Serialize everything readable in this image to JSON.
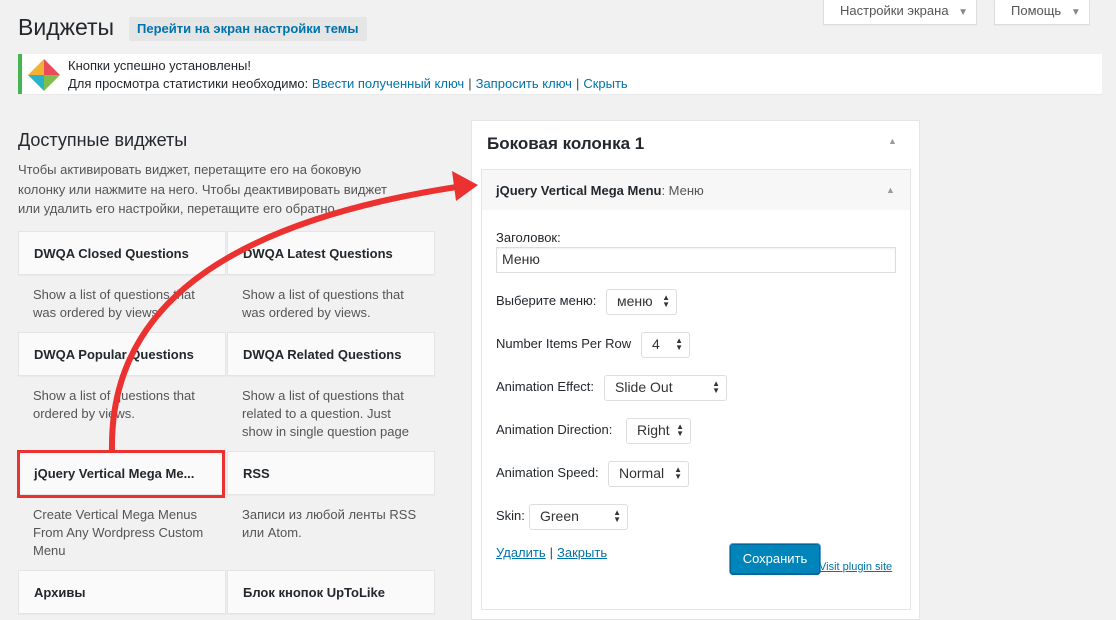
{
  "header": {
    "title": "Виджеты",
    "action_label": "Перейти на экран настройки темы",
    "screen_options": "Настройки экрана",
    "help": "Помощь"
  },
  "notice": {
    "line1": "Кнопки успешно установлены!",
    "line2_prefix": "Для просмотра статистики необходимо:",
    "link_enter_key": "Ввести полученный ключ",
    "link_request_key": "Запросить ключ",
    "link_hide": "Скрыть"
  },
  "available": {
    "heading": "Доступные виджеты",
    "description": "Чтобы активировать виджет, перетащите его на боковую колонку или нажмите на него. Чтобы деактивировать виджет или удалить его настройки, перетащите его обратно.",
    "widgets": [
      {
        "title": "DWQA Closed Questions",
        "desc": "Show a list of questions that was ordered by views."
      },
      {
        "title": "DWQA Latest Questions",
        "desc": "Show a list of questions that was ordered by views."
      },
      {
        "title": "DWQA Popular Questions",
        "desc": "Show a list of questions that ordered by views."
      },
      {
        "title": "DWQA Related Questions",
        "desc": "Show a list of questions that related to a question. Just show in single question page"
      },
      {
        "title": "jQuery Vertical Mega Me...",
        "desc": "Create Vertical Mega Menus From Any Wordpress Custom Menu"
      },
      {
        "title": "RSS",
        "desc": "Записи из любой ленты RSS или Atom."
      },
      {
        "title": "Архивы",
        "desc": ""
      },
      {
        "title": "Блок кнопок UpToLike",
        "desc": ""
      }
    ]
  },
  "sidebar": {
    "title": "Боковая колонка 1",
    "widget": {
      "title": "jQuery Vertical Mega Menu",
      "subtitle": ": Меню",
      "title_label": "Заголовок:",
      "title_value": "Меню",
      "menu_label": "Выберите меню:",
      "menu_value": "меню",
      "per_row_label": "Number Items Per Row",
      "per_row_value": "4",
      "effect_label": "Animation Effect:",
      "effect_value": "Slide Out",
      "direction_label": "Animation Direction:",
      "direction_value": "Right",
      "speed_label": "Animation Speed:",
      "speed_value": "Normal",
      "skin_label": "Skin:",
      "skin_value": "Green",
      "delete_label": "Удалить",
      "close_label": "Закрыть",
      "save_label": "Сохранить",
      "plugin_link": "Visit plugin site"
    }
  },
  "colors": {
    "accent": "#0073aa",
    "primary_button": "#0085ba",
    "annotation_red": "#ec3131",
    "notice_green": "#46b450"
  }
}
